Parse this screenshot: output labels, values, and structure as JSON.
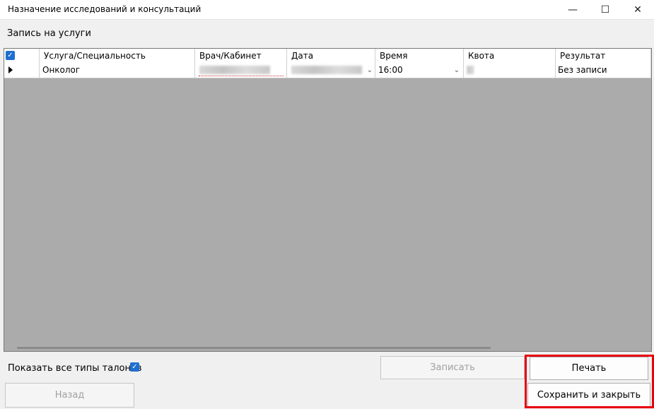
{
  "window": {
    "title": "Назначение исследований и консультаций",
    "controls": {
      "minimize": "—",
      "maximize": "☐",
      "close": "✕"
    }
  },
  "section_label": "Запись на услуги",
  "grid": {
    "select_all_checked": true,
    "columns": [
      "Услуга/Специальность",
      "Врач/Кабинет",
      "Дата",
      "Время",
      "Квота",
      "Результат"
    ],
    "rows": [
      {
        "service": "Онколог",
        "doctor": "",
        "date": "",
        "time": "16:00",
        "quota": "",
        "result": "Без записи"
      }
    ]
  },
  "icons": {
    "check": "✓",
    "combo_arrow": "⌄",
    "row_indicator": "triangle-right-icon"
  },
  "bottom": {
    "show_all_label": "Показать все типы талонов",
    "show_all_checked": true,
    "record_button": "Записать",
    "print_button": "Печать",
    "back_button": "Назад",
    "save_close_button": "Сохранить и закрыть"
  },
  "colors": {
    "accent": "#1e6fd0",
    "highlight": "#e8000b",
    "grid_empty_area": "#ababab"
  }
}
